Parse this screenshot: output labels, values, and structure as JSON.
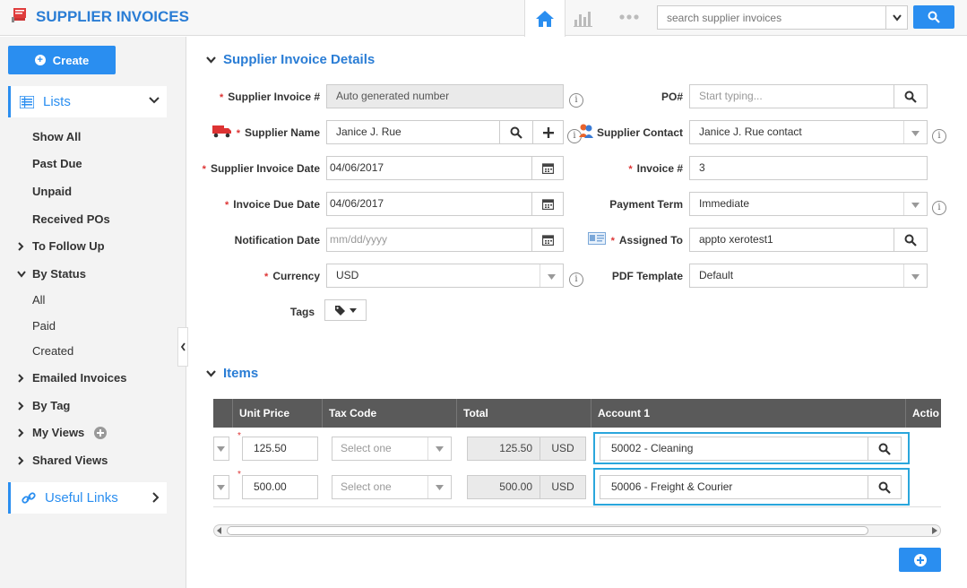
{
  "app": {
    "title": "SUPPLIER INVOICES",
    "accent": "#2a8ef0"
  },
  "search": {
    "placeholder": "search supplier invoices"
  },
  "sidebar": {
    "create_label": "Create",
    "lists_label": "Lists",
    "items": [
      "Show All",
      "Past Due",
      "Unpaid",
      "Received POs"
    ],
    "to_follow_up": "To Follow Up",
    "by_status": "By Status",
    "status_items": [
      "All",
      "Paid",
      "Created"
    ],
    "emailed_invoices": "Emailed Invoices",
    "by_tag": "By Tag",
    "my_views": "My Views",
    "shared_views": "Shared Views",
    "useful_links": "Useful Links"
  },
  "details": {
    "title": "Supplier Invoice Details",
    "supplier_invoice_no_label": "Supplier Invoice #",
    "supplier_invoice_no_value": "Auto generated number",
    "po_label": "PO#",
    "po_placeholder": "Start typing...",
    "supplier_name_label": "Supplier Name",
    "supplier_name_value": "Janice J. Rue",
    "supplier_contact_label": "Supplier Contact",
    "supplier_contact_value": "Janice J. Rue contact",
    "supplier_invoice_date_label": "Supplier Invoice Date",
    "supplier_invoice_date_value": "04/06/2017",
    "invoice_no_label": "Invoice #",
    "invoice_no_value": "3",
    "invoice_due_date_label": "Invoice Due Date",
    "invoice_due_date_value": "04/06/2017",
    "payment_term_label": "Payment Term",
    "payment_term_value": "Immediate",
    "notification_date_label": "Notification Date",
    "notification_date_placeholder": "mm/dd/yyyy",
    "assigned_to_label": "Assigned To",
    "assigned_to_value": "appto xerotest1",
    "currency_label": "Currency",
    "currency_value": "USD",
    "pdf_template_label": "PDF Template",
    "pdf_template_value": "Default",
    "tags_label": "Tags",
    "info_glyph": "i"
  },
  "items": {
    "title": "Items",
    "columns": [
      "Unit Price",
      "Tax Code",
      "Total",
      "Account 1",
      "Actio"
    ],
    "rows": [
      {
        "unit_price": "125.50",
        "tax_placeholder": "Select one",
        "total": "125.50",
        "currency": "USD",
        "account": "50002 - Cleaning"
      },
      {
        "unit_price": "500.00",
        "tax_placeholder": "Select one",
        "total": "500.00",
        "currency": "USD",
        "account": "50006 - Freight & Courier"
      }
    ]
  }
}
